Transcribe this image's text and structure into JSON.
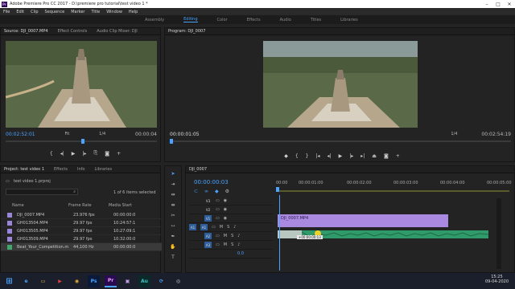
{
  "window": {
    "title": "Adobe Premiere Pro CC 2017 - D:\\premiere pro tutorial\\test video 1 *",
    "app_badge": "Pr"
  },
  "menu": [
    "File",
    "Edit",
    "Clip",
    "Sequence",
    "Marker",
    "Title",
    "Window",
    "Help"
  ],
  "workspaces": [
    "Assembly",
    "Editing",
    "Color",
    "Effects",
    "Audio",
    "Titles",
    "Libraries"
  ],
  "source_panel": {
    "tabs": [
      "Source: DJI_0007.MP4",
      "Effect Controls",
      "Audio Clip Mixer: DJI"
    ],
    "timecode": "00:02:52:01",
    "fit": "Fit",
    "ratio": "1/4",
    "duration": "00:00:04"
  },
  "program_panel": {
    "tabs": [
      "Program: DJI_0007"
    ],
    "timecode": "00:00:01:05",
    "fit": "Fit",
    "ratio": "1/4",
    "duration": "00:02:54:19"
  },
  "project_panel": {
    "tabs": [
      "Project: test video 1",
      "Effects",
      "Info",
      "Libraries"
    ],
    "project_file": "test video 1.prproj",
    "selection": "1 of 6 items selected",
    "columns": [
      "Name",
      "Frame Rate",
      "Media Start"
    ],
    "items": [
      {
        "name": "DJI_0007.MP4",
        "frame_rate": "23.976 fps",
        "media_start": "00:00:00:0",
        "color": "#9a86d8"
      },
      {
        "name": "GH013504.MP4",
        "frame_rate": "29.97 fps",
        "media_start": "10:24:57:1",
        "color": "#9a86d8"
      },
      {
        "name": "GH013505.MP4",
        "frame_rate": "29.97 fps",
        "media_start": "10:27:09:1",
        "color": "#9a86d8"
      },
      {
        "name": "GH013509.MP4",
        "frame_rate": "29.97 fps",
        "media_start": "10:32:00:0",
        "color": "#9a86d8"
      },
      {
        "name": "Beat_Your_Competition.m",
        "frame_rate": "44,100 Hz",
        "media_start": "00:00:00:0",
        "color": "#3fa86a"
      }
    ]
  },
  "timeline": {
    "tab": "DJI_0007",
    "timecode": "00:00:00:03",
    "ruler": [
      "00:00",
      "00:00:01:00",
      "00:00:02:00",
      "00:00:03:00",
      "00:00:04:00",
      "00:00:05:00"
    ],
    "tracks": [
      "V3",
      "V2",
      "V1",
      "A1",
      "A2",
      "A3"
    ],
    "source_patch": "A1",
    "master_value": "0.0",
    "video_clip": "DJI_0007.MP4",
    "drag_tooltip": "+00:00:00:13"
  },
  "taskbar": {
    "time": "15:25",
    "date": "09-04-2020"
  }
}
